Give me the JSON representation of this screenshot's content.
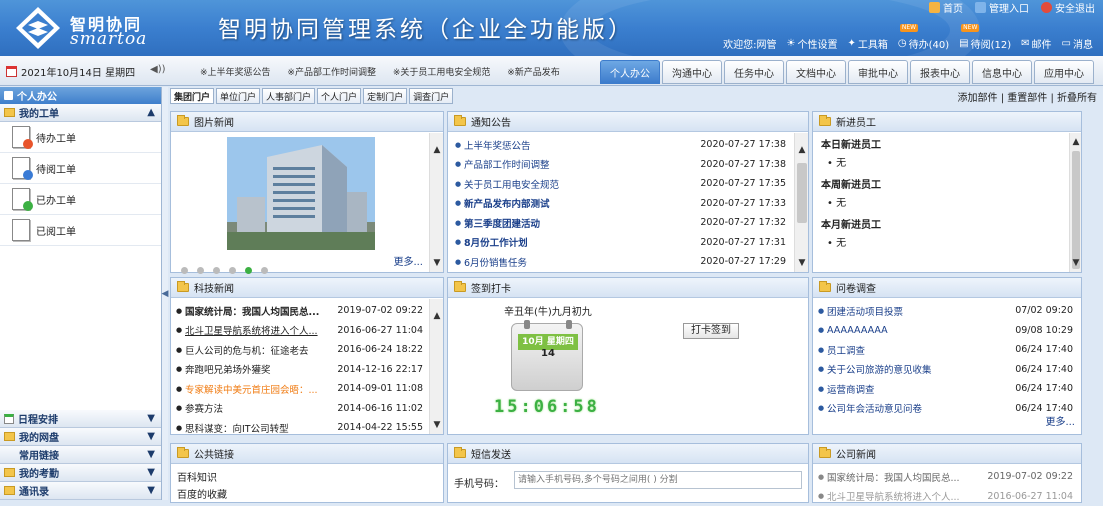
{
  "header": {
    "logo_cn": "智明协同",
    "logo_en": "smartoa",
    "title": "智明协同管理系统（企业全功能版）",
    "top_links": [
      {
        "label": "首页",
        "icon": "home-icon",
        "color": "#f5b342"
      },
      {
        "label": "管理入口",
        "icon": "admin-icon",
        "color": "#7fb4ea"
      },
      {
        "label": "安全退出",
        "icon": "logout-icon",
        "color": "#e34b3b"
      }
    ],
    "welcome": "欢迎您:网管",
    "user_links": [
      {
        "label": "个性设置",
        "icon": "settings-icon",
        "new": ""
      },
      {
        "label": "工具箱",
        "icon": "toolbox-icon",
        "new": ""
      },
      {
        "label": "待办(40)",
        "icon": "clock-icon",
        "new": "NEW"
      },
      {
        "label": "待阅(12)",
        "icon": "read-icon",
        "new": "NEW"
      },
      {
        "label": "邮件",
        "icon": "mail-icon",
        "new": ""
      },
      {
        "label": "消息",
        "icon": "message-icon",
        "new": ""
      }
    ]
  },
  "navbar": {
    "date": "2021年10月14日 星期四",
    "marquee": [
      "※上半年奖惩公告",
      "※产品部工作时间调整",
      "※关于员工用电安全规范",
      "※新产品发布"
    ],
    "tabs": [
      {
        "label": "个人办公",
        "active": true
      },
      {
        "label": "沟通中心",
        "active": false
      },
      {
        "label": "任务中心",
        "active": false
      },
      {
        "label": "文档中心",
        "active": false
      },
      {
        "label": "审批中心",
        "active": false
      },
      {
        "label": "报表中心",
        "active": false
      },
      {
        "label": "信息中心",
        "active": false
      },
      {
        "label": "应用中心",
        "active": false
      }
    ]
  },
  "sidebar": {
    "heading": "个人办公",
    "my_work": "我的工单",
    "items": [
      {
        "label": "待办工单",
        "badge_color": "#e8542b"
      },
      {
        "label": "待阅工单",
        "badge_color": "#3a7bd5"
      },
      {
        "label": "已办工单",
        "badge_color": "#3cb043"
      },
      {
        "label": "已阅工单",
        "badge_color": ""
      }
    ],
    "bottom_sections": [
      {
        "label": "日程安排",
        "icon": "calendar-icon"
      },
      {
        "label": "我的网盘",
        "icon": "disk-icon"
      },
      {
        "label": "常用链接",
        "icon": ""
      },
      {
        "label": "我的考勤",
        "icon": "attendance-icon"
      },
      {
        "label": "通讯录",
        "icon": "contacts-icon"
      }
    ]
  },
  "portal": {
    "tabs": [
      {
        "label": "集团门户",
        "active": true
      },
      {
        "label": "单位门户",
        "active": false
      },
      {
        "label": "人事部门户",
        "active": false
      },
      {
        "label": "个人门户",
        "active": false
      },
      {
        "label": "定制门户",
        "active": false
      },
      {
        "label": "调查门户",
        "active": false
      }
    ],
    "actions": "添加部件 | 重置部件 | 折叠所有"
  },
  "panels": {
    "photo_news": {
      "title": "图片新闻",
      "more": "更多..."
    },
    "notice": {
      "title": "通知公告",
      "rows": [
        {
          "title": "上半年奖惩公告",
          "date": "2020-07-27 17:38",
          "bold": false
        },
        {
          "title": "产品部工作时间调整",
          "date": "2020-07-27 17:38",
          "bold": false
        },
        {
          "title": "关于员工用电安全规范",
          "date": "2020-07-27 17:35",
          "bold": false
        },
        {
          "title": "新产品发布内部测试",
          "date": "2020-07-27 17:33",
          "bold": true
        },
        {
          "title": "第三季度团建活动",
          "date": "2020-07-27 17:32",
          "bold": true
        },
        {
          "title": "8月份工作计划",
          "date": "2020-07-27 17:31",
          "bold": true
        },
        {
          "title": "6月份销售任务",
          "date": "2020-07-27 17:29",
          "bold": false
        }
      ]
    },
    "new_staff": {
      "title": "新进员工",
      "groups": [
        {
          "heading": "本日新进员工",
          "value": "无"
        },
        {
          "heading": "本周新进员工",
          "value": "无"
        },
        {
          "heading": "本月新进员工",
          "value": "无"
        }
      ]
    },
    "tech_news": {
      "title": "科技新闻",
      "rows": [
        {
          "title": "国家统计局：我国人均国民总...",
          "date": "2019-07-02 09:22",
          "style": "bold"
        },
        {
          "title": "北斗卫星导航系统将进入个人...",
          "date": "2016-06-27 11:04",
          "style": "underline"
        },
        {
          "title": "巨人公司的危与机：征途老去",
          "date": "2016-06-24 18:22",
          "style": ""
        },
        {
          "title": "奔跑吧兄弟场外獾奖",
          "date": "2014-12-16 22:17",
          "style": ""
        },
        {
          "title": "专家解读中美元首庄园会晤：...",
          "date": "2014-09-01 11:08",
          "style": "orange"
        },
        {
          "title": "参赛方法",
          "date": "2014-06-16 11:02",
          "style": ""
        },
        {
          "title": "思科谋变：向IT公司转型",
          "date": "2014-04-22 15:55",
          "style": ""
        }
      ]
    },
    "checkin": {
      "title": "签到打卡",
      "lunar": "辛丑年(牛)九月初九",
      "cal_month": "10月 星期四",
      "cal_day": "14",
      "clock": "15:06:58",
      "button": "打卡签到"
    },
    "survey": {
      "title": "问卷调查",
      "rows": [
        {
          "title": "团建活动项目投票",
          "date": "07/02 09:20"
        },
        {
          "title": "AAAAAAAAA",
          "date": "09/08 10:29"
        },
        {
          "title": "员工调查",
          "date": "06/24 17:40"
        },
        {
          "title": "关于公司旅游的意见收集",
          "date": "06/24 17:40"
        },
        {
          "title": "运营商调查",
          "date": "06/24 17:40"
        },
        {
          "title": "公司年会活动意见问卷",
          "date": "06/24 17:40"
        }
      ],
      "more": "更多..."
    },
    "links": {
      "title": "公共链接",
      "rows": [
        "百科知识",
        "百度的收藏"
      ]
    },
    "sms": {
      "title": "短信发送",
      "phone_label": "手机号码：",
      "placeholder": "请输入手机号码,多个号码之间用( ) 分割"
    },
    "company_news": {
      "title": "公司新闻",
      "rows": [
        {
          "title": "国家统计局：我国人均国民总...",
          "date": "2019-07-02 09:22"
        },
        {
          "title": "北斗卫星导航系统将进入个人...",
          "date": "2016-06-27 11:04"
        }
      ]
    }
  },
  "colors": {
    "header_blue": "#3b7fcf",
    "active_tab": "#3d7ccc",
    "link_blue": "#1a3f8a",
    "orange_news": "#f07b12"
  }
}
